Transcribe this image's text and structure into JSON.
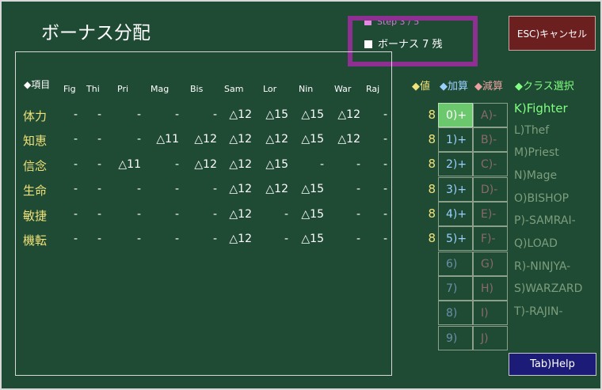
{
  "window": {
    "title": "ボーナス分配"
  },
  "status": {
    "step": "Step 3 / 5",
    "bonus": "ボーナス 7 残"
  },
  "esc_button": "ESC)キャンセル",
  "help_button": "Tab)Help",
  "table": {
    "item_header": "◆項目",
    "classes": [
      "Fig",
      "Thi",
      "Pri",
      "Mag",
      "Bis",
      "Sam",
      "Lor",
      "Nin",
      "War",
      "Raj"
    ],
    "rows": [
      {
        "label": "体力",
        "cells": [
          "-",
          "-",
          "-",
          "-",
          "-",
          "△12",
          "△15",
          "△15",
          "△12",
          "-"
        ]
      },
      {
        "label": "知恵",
        "cells": [
          "-",
          "-",
          "-",
          "△11",
          "△12",
          "△12",
          "△12",
          "△15",
          "△12",
          "-"
        ]
      },
      {
        "label": "信念",
        "cells": [
          "-",
          "-",
          "△11",
          "-",
          "△12",
          "△12",
          "△15",
          "-",
          "-",
          "-"
        ]
      },
      {
        "label": "生命",
        "cells": [
          "-",
          "-",
          "-",
          "-",
          "-",
          "△12",
          "△12",
          "△15",
          "-",
          "-"
        ]
      },
      {
        "label": "敏捷",
        "cells": [
          "-",
          "-",
          "-",
          "-",
          "-",
          "△12",
          "-",
          "△15",
          "-",
          "-"
        ]
      },
      {
        "label": "機転",
        "cells": [
          "-",
          "-",
          "-",
          "-",
          "-",
          "△12",
          "-",
          "△15",
          "-",
          "-"
        ]
      }
    ]
  },
  "legend": {
    "value": "◆値",
    "add": "◆加算",
    "sub": "◆減算",
    "class_select": "◆クラス選択"
  },
  "stats": [
    {
      "value": "8",
      "plus": "0)+",
      "minus": "A)-"
    },
    {
      "value": "8",
      "plus": "1)+",
      "minus": "B)-"
    },
    {
      "value": "8",
      "plus": "2)+",
      "minus": "C)-"
    },
    {
      "value": "8",
      "plus": "3)+",
      "minus": "D)-"
    },
    {
      "value": "8",
      "plus": "4)+",
      "minus": "E)-"
    },
    {
      "value": "8",
      "plus": "5)+",
      "minus": "F)-"
    },
    {
      "value": "",
      "plus": "6)",
      "minus": "G)"
    },
    {
      "value": "",
      "plus": "7)",
      "minus": "H)"
    },
    {
      "value": "",
      "plus": "8)",
      "minus": "I)"
    },
    {
      "value": "",
      "plus": "9)",
      "minus": "J)"
    }
  ],
  "class_list": [
    "K)Fighter",
    "L)Thef",
    "M)Priest",
    "N)Mage",
    "O)BISHOP",
    "P)-SAMRAI-",
    "Q)LOAD",
    "R)-NINJYA-",
    "S)WARZARD",
    "T)-RAJIN-"
  ],
  "colors": {
    "background": "#1f4a34",
    "highlight": "#8e2f92",
    "stat_label": "#f0e27a",
    "selected_class": "#80ff80",
    "add": "#9ad0ff",
    "sub": "#e8a0a0"
  }
}
